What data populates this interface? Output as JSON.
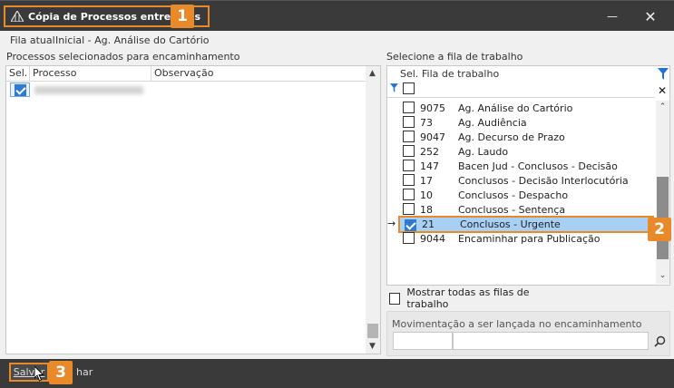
{
  "window": {
    "title": "Cópia de Processos entre Filas",
    "title_badge": "1",
    "close_label": "✕",
    "minimize_label": "—"
  },
  "current_queue": {
    "label": "Fila atual",
    "value": "Inicial - Ag. Análise do Cartório"
  },
  "left_panel": {
    "label": "Processos selecionados para encaminhamento",
    "columns": [
      "Sel.",
      "Processo",
      "Observação"
    ],
    "rows": [
      {
        "checked": true,
        "process": "",
        "observation": ""
      }
    ]
  },
  "right_panel": {
    "label": "Selecione a fila de trabalho",
    "columns": [
      "Sel.",
      "Fila de trabalho"
    ],
    "queues": [
      {
        "code": "9075",
        "name": "Ag. Análise do Cartório",
        "checked": false
      },
      {
        "code": "73",
        "name": "Ag. Audiência",
        "checked": false
      },
      {
        "code": "9047",
        "name": "Ag. Decurso de Prazo",
        "checked": false
      },
      {
        "code": "252",
        "name": "Ag. Laudo",
        "checked": false
      },
      {
        "code": "147",
        "name": "Bacen Jud - Conclusos - Decisão",
        "checked": false
      },
      {
        "code": "17",
        "name": "Conclusos - Decisão Interlocutória",
        "checked": false
      },
      {
        "code": "10",
        "name": "Conclusos - Despacho",
        "checked": false
      },
      {
        "code": "18",
        "name": "Conclusos - Sentença",
        "checked": false
      },
      {
        "code": "21",
        "name": "Conclusos - Urgente",
        "checked": true
      },
      {
        "code": "9044",
        "name": "Encaminhar para Publicação",
        "checked": false
      }
    ],
    "selected_badge": "2",
    "show_all_label": "Mostrar todas as filas de trabalho",
    "movement_label": "Movimentação a ser lançada no encaminhamento"
  },
  "footer": {
    "save_label": "Salvar",
    "save_badge": "3",
    "cancel_label": "har"
  },
  "colors": {
    "accent": "#e8892a",
    "titlebar": "#3a3a3a",
    "selection": "#a8d0f5",
    "checkbox": "#2f7bd2",
    "filter_icon": "#1e73d8"
  }
}
